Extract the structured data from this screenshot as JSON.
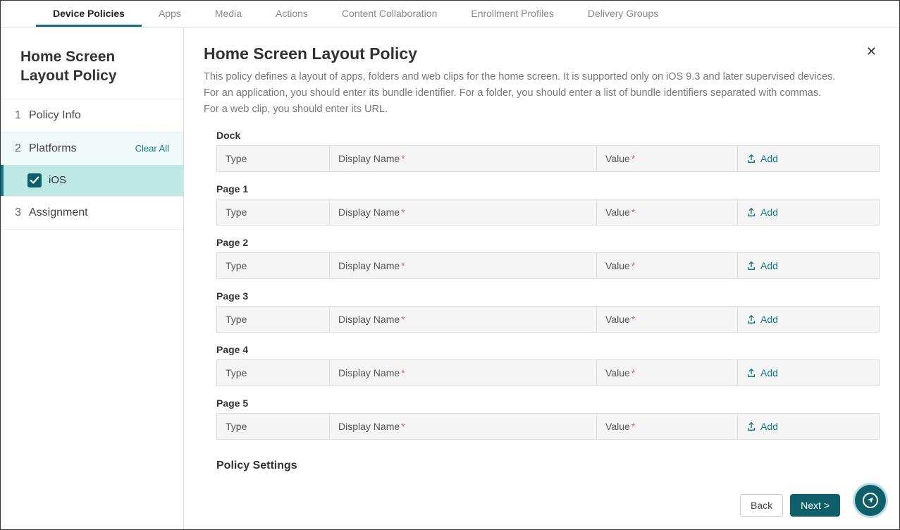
{
  "topnav": {
    "items": [
      {
        "label": "Device Policies",
        "active": true
      },
      {
        "label": "Apps"
      },
      {
        "label": "Media"
      },
      {
        "label": "Actions"
      },
      {
        "label": "Content Collaboration"
      },
      {
        "label": "Enrollment Profiles"
      },
      {
        "label": "Delivery Groups"
      }
    ]
  },
  "sidebar": {
    "title": "Home Screen Layout Policy",
    "steps": [
      {
        "num": "1",
        "label": "Policy Info"
      },
      {
        "num": "2",
        "label": "Platforms",
        "clear_all": "Clear All"
      },
      {
        "num": "3",
        "label": "Assignment"
      }
    ],
    "platform_label": "iOS"
  },
  "main": {
    "title": "Home Screen Layout Policy",
    "desc_line1": "This policy defines a layout of apps, folders and web clips for the home screen. It is supported only on iOS 9.3 and later supervised devices.",
    "desc_line2": "For an application, you should enter its bundle identifier. For a folder, you should enter a list of bundle identifiers separated with commas.",
    "desc_line3": "For a web clip, you should enter its URL.",
    "columns": {
      "type": "Type",
      "name": "Display Name",
      "value": "Value",
      "add": "Add"
    },
    "sections": [
      {
        "label": "Dock"
      },
      {
        "label": "Page 1"
      },
      {
        "label": "Page 2"
      },
      {
        "label": "Page 3"
      },
      {
        "label": "Page 4"
      },
      {
        "label": "Page 5"
      }
    ],
    "policy_settings": "Policy Settings",
    "back": "Back",
    "next": "Next >"
  }
}
